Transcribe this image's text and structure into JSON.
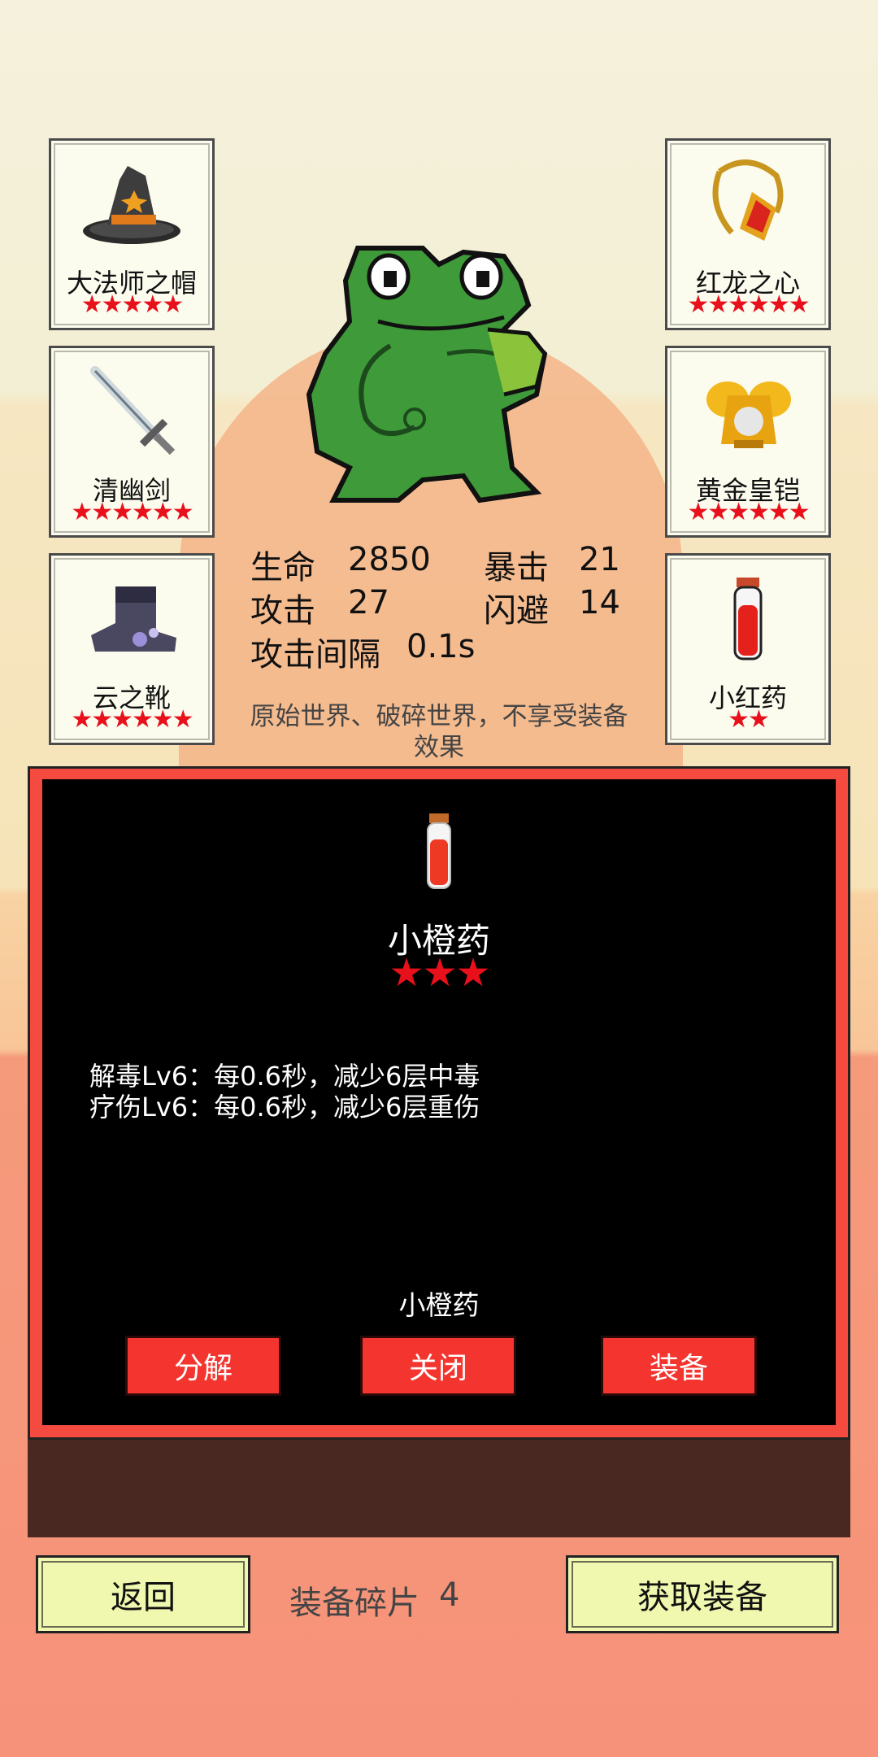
{
  "equipment": {
    "left": [
      {
        "name": "大法师之帽",
        "stars": "★★★★★",
        "icon": "wizard-hat-icon"
      },
      {
        "name": "清幽剑",
        "stars": "★★★★★★",
        "icon": "sword-icon"
      },
      {
        "name": "云之靴",
        "stars": "★★★★★★",
        "icon": "boots-icon"
      }
    ],
    "right": [
      {
        "name": "红龙之心",
        "stars": "★★★★★★",
        "icon": "amulet-icon"
      },
      {
        "name": "黄金皇铠",
        "stars": "★★★★★★",
        "icon": "golden-armor-icon"
      },
      {
        "name": "小红药",
        "stars": "★★",
        "icon": "red-potion-icon"
      }
    ]
  },
  "stats": {
    "hp_label": "生命",
    "hp_value": "2850",
    "crit_label": "暴击",
    "crit_value": "21",
    "atk_label": "攻击",
    "atk_value": "27",
    "dodge_label": "闪避",
    "dodge_value": "14",
    "interval_label": "攻击间隔",
    "interval_value": "0.1s"
  },
  "world_note": "原始世界、破碎世界，不享受装备效果",
  "detail": {
    "icon": "orange-potion-icon",
    "title": "小橙药",
    "stars": "★★★",
    "effects": [
      "解毒Lv6：每0.6秒，减少6层中毒",
      "疗伤Lv6：每0.6秒，减少6层重伤"
    ],
    "footer_name": "小橙药",
    "buttons": {
      "decompose": "分解",
      "close": "关闭",
      "equip": "装备"
    }
  },
  "bottom": {
    "back": "返回",
    "fragments_label": "装备碎片",
    "fragments_value": "4",
    "get_equipment": "获取装备"
  },
  "colors": {
    "accent_red": "#f44a40",
    "star_red": "#e8101a",
    "button_yellow": "#f0f7ae",
    "frog_green": "#3f9a3a"
  }
}
